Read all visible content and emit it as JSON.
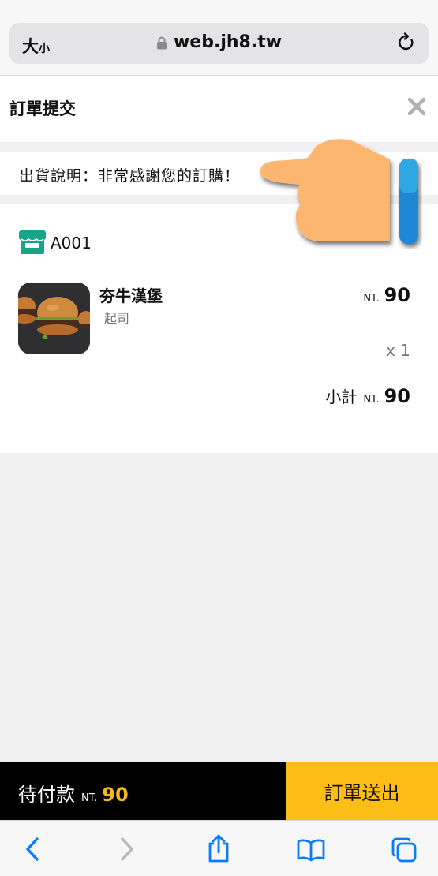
{
  "browser": {
    "text_size_label": "大",
    "text_size_small": "小",
    "url": "web.jh8.tw"
  },
  "header": {
    "title": "訂單提交"
  },
  "notice": {
    "text": "出貨說明：非常感謝您的訂購！"
  },
  "order": {
    "shop_name": "A001",
    "item": {
      "name": "夯牛漢堡",
      "option": "起司",
      "currency": "NT.",
      "price": "90",
      "quantity": "x 1"
    },
    "subtotal_label": "小計",
    "subtotal_currency": "NT.",
    "subtotal": "90"
  },
  "checkout": {
    "due_label": "待付款",
    "currency": "NT.",
    "amount": "90",
    "submit_label": "訂單送出"
  },
  "colors": {
    "accent": "#fbbd16",
    "shop_icon": "#17a589",
    "browser_tint": "#0a7aff"
  }
}
